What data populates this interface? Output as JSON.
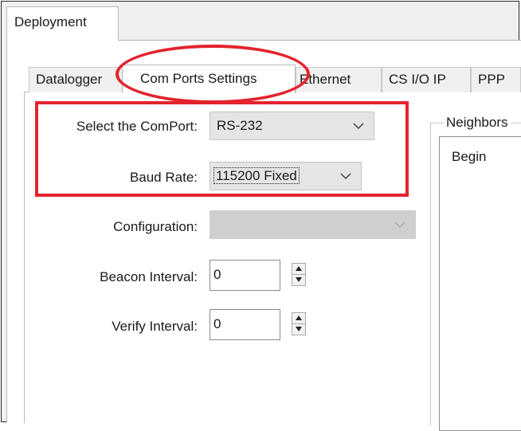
{
  "window": {
    "main_tab": "Deployment"
  },
  "tabs": [
    {
      "label": "Datalogger"
    },
    {
      "label": "Com Ports Settings"
    },
    {
      "label": "Ethernet"
    },
    {
      "label": "CS I/O IP"
    },
    {
      "label": "PPP"
    }
  ],
  "form": {
    "comport_label": "Select the ComPort:",
    "comport_value": "RS-232",
    "baud_label": "Baud Rate:",
    "baud_value": "115200 Fixed",
    "config_label": "Configuration:",
    "config_value": "",
    "beacon_label": "Beacon Interval:",
    "beacon_value": "0",
    "verify_label": "Verify Interval:",
    "verify_value": "0"
  },
  "neighbors": {
    "title": "Neighbors",
    "items": [
      "Begin"
    ]
  },
  "annotations": {
    "highlight_color": "#e3232d"
  },
  "icons": {
    "dropdown": "chevron-down-icon",
    "spin_up": "triangle-up-icon",
    "spin_down": "triangle-down-icon"
  }
}
